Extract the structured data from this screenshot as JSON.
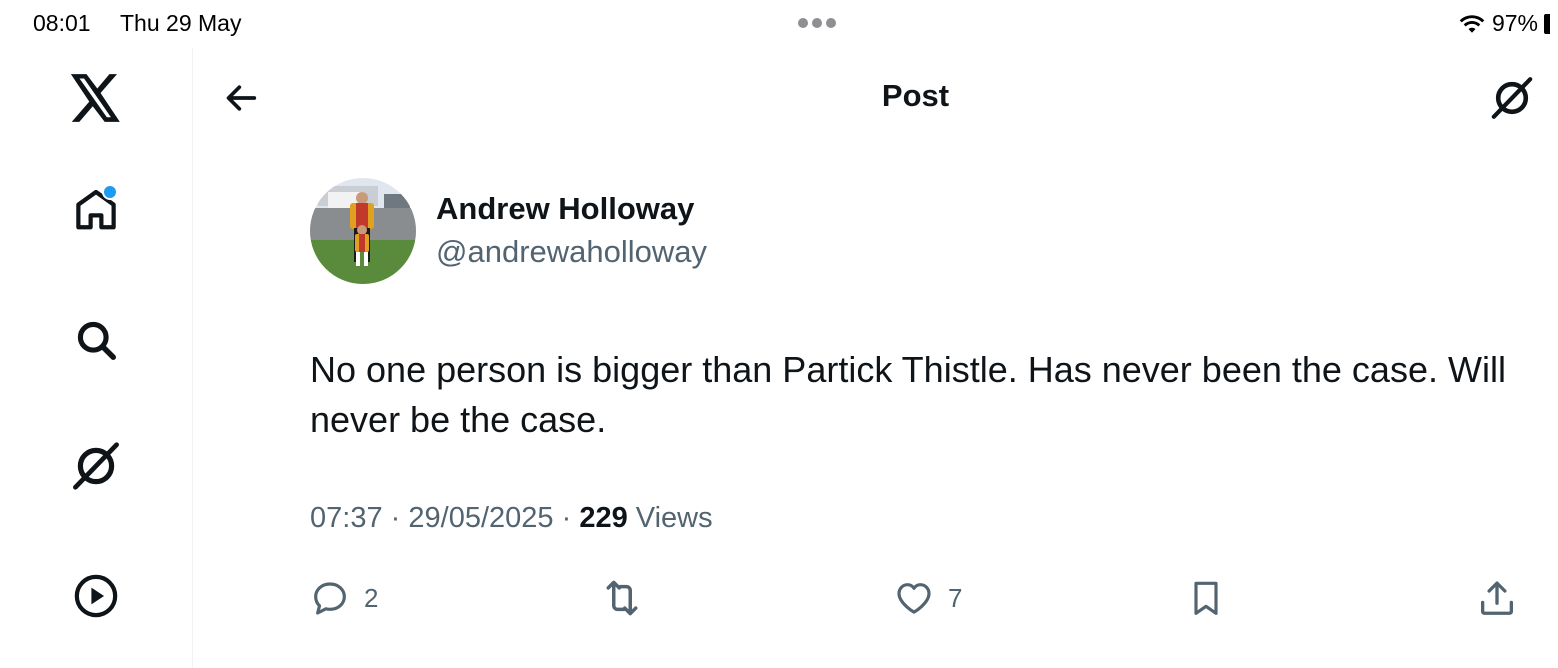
{
  "status_bar": {
    "time": "08:01",
    "date": "Thu 29 May",
    "battery": "97%"
  },
  "sidebar": {
    "items": [
      {
        "icon": "x-logo-icon"
      },
      {
        "icon": "home-icon",
        "has_notification": true
      },
      {
        "icon": "search-icon"
      },
      {
        "icon": "grok-icon"
      },
      {
        "icon": "video-play-icon"
      }
    ]
  },
  "header": {
    "title": "Post"
  },
  "post": {
    "author_name": "Andrew Holloway",
    "author_handle": "@andrewaholloway",
    "text": "No one person is bigger than Partick Thistle. Has never been the case. Will never be the case.",
    "time": "07:37",
    "separator": "·",
    "date": "29/05/2025",
    "views_count": "229",
    "views_label": "Views"
  },
  "actions": {
    "reply_count": "2",
    "like_count": "7"
  },
  "colors": {
    "accent": "#1d9bf0",
    "text_primary": "#0f1419",
    "text_secondary": "#536471"
  }
}
